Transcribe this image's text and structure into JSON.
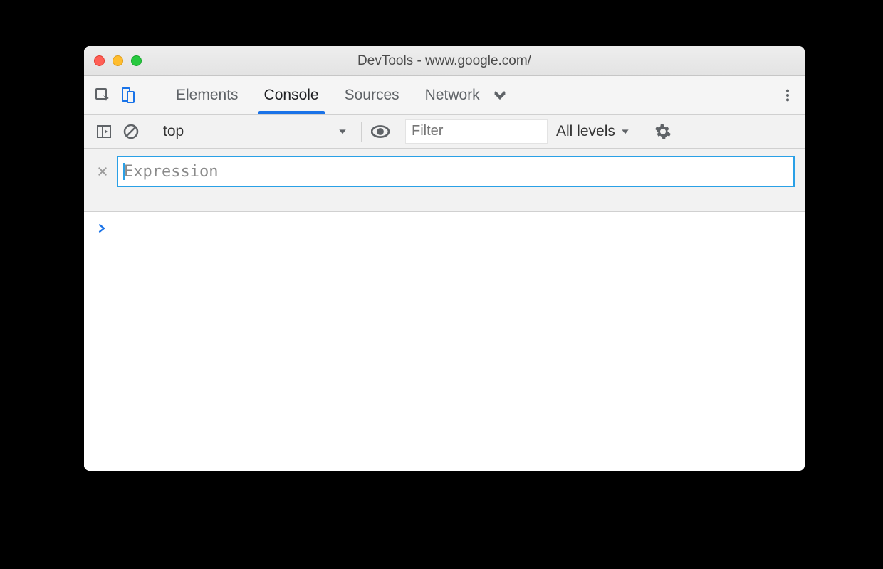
{
  "window": {
    "title": "DevTools - www.google.com/"
  },
  "tabs": {
    "items": [
      "Elements",
      "Console",
      "Sources",
      "Network"
    ],
    "active": "Console"
  },
  "console_toolbar": {
    "context": "top",
    "filter_placeholder": "Filter",
    "filter_value": "",
    "levels_label": "All levels"
  },
  "live_expression": {
    "placeholder": "Expression",
    "value": ""
  },
  "prompt": "›"
}
